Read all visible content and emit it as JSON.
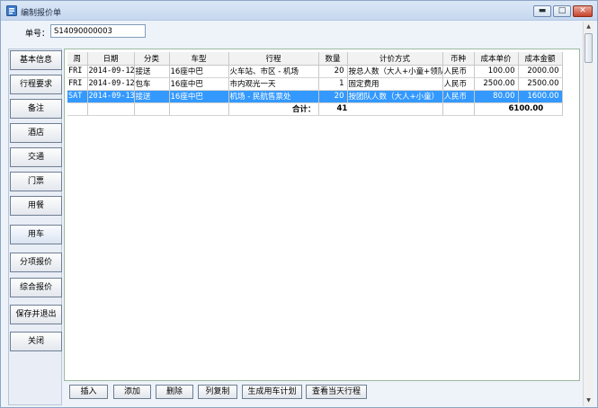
{
  "window": {
    "title": "编制报价单",
    "controls": [
      "▬",
      "□",
      "✕"
    ]
  },
  "order": {
    "label": "单号：",
    "value": "S14090000003"
  },
  "nav": [
    "基本信息",
    "行程要求",
    "备注",
    "酒店",
    "交通",
    "门票",
    "用餐",
    "用车",
    "分项报价",
    "综合报价",
    "保存并退出",
    "关闭"
  ],
  "nav_active": "用车",
  "grid": {
    "headers": [
      "周",
      "日期",
      "分类",
      "车型",
      "行程",
      "数量",
      "计价方式",
      "币种",
      "成本单价",
      "成本金额"
    ],
    "rows": [
      [
        "FRI",
        "2014-09-12",
        "接送",
        "16座中巴",
        "火车站、市区 - 机场",
        "20",
        "按总人数（大人+小童+领队）",
        "人民币",
        "100.00",
        "2000.00"
      ],
      [
        "FRI",
        "2014-09-12",
        "包车",
        "16座中巴",
        "市内观光一天",
        "1",
        "固定费用",
        "人民币",
        "2500.00",
        "2500.00"
      ],
      [
        "SAT",
        "2014-09-13",
        "接送",
        "16座中巴",
        "机场 - 民航售票处",
        "20",
        "按团队人数（大人+小童）",
        "人民币",
        "80.00",
        "1600.00"
      ]
    ],
    "selected_row": 2,
    "total": {
      "label": "合计：",
      "quantity": "41",
      "amount": "6100.00"
    }
  },
  "actions": [
    "插入",
    "添加",
    "删除",
    "列复制",
    "生成用车计划",
    "查看当天行程"
  ],
  "scroll": {
    "up": "▲",
    "down": "▼"
  }
}
